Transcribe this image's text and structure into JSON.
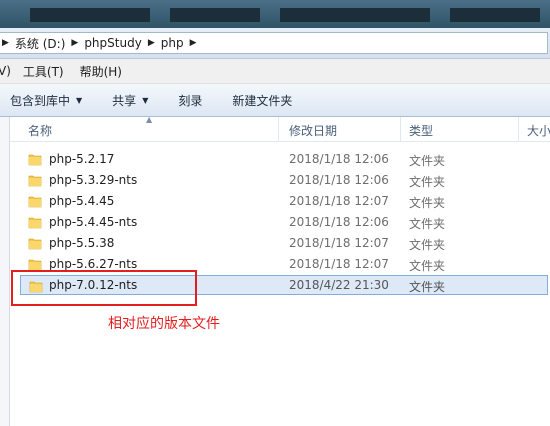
{
  "address": {
    "crumbs": [
      "系统 (D:)",
      "phpStudy",
      "php"
    ]
  },
  "menu": {
    "items": [
      "V)",
      "工具(T)",
      "帮助(H)"
    ]
  },
  "toolbar": {
    "include_library": "包含到库中",
    "share": "共享",
    "burn": "刻录",
    "new_folder": "新建文件夹"
  },
  "columns": {
    "name": "名称",
    "date": "修改日期",
    "type": "类型",
    "size": "大小"
  },
  "files": [
    {
      "name": "php-5.2.17",
      "date": "2018/1/18 12:06",
      "type": "文件夹"
    },
    {
      "name": "php-5.3.29-nts",
      "date": "2018/1/18 12:06",
      "type": "文件夹"
    },
    {
      "name": "php-5.4.45",
      "date": "2018/1/18 12:07",
      "type": "文件夹"
    },
    {
      "name": "php-5.4.45-nts",
      "date": "2018/1/18 12:06",
      "type": "文件夹"
    },
    {
      "name": "php-5.5.38",
      "date": "2018/1/18 12:07",
      "type": "文件夹"
    },
    {
      "name": "php-5.6.27-nts",
      "date": "2018/1/18 12:07",
      "type": "文件夹"
    },
    {
      "name": "php-7.0.12-nts",
      "date": "2018/4/22 21:30",
      "type": "文件夹"
    }
  ],
  "annotation": "相对应的版本文件",
  "colors": {
    "annotation_red": "#e31e1e",
    "selection_bg": "#dde9f7",
    "folder_yellow": "#f5c842"
  }
}
